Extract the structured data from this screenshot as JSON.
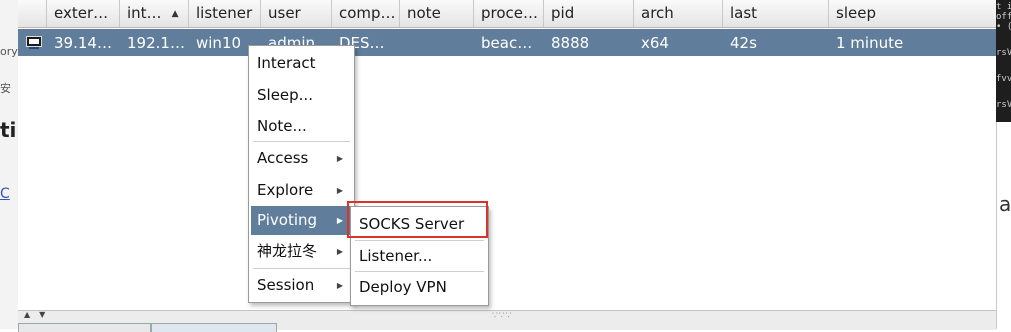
{
  "table": {
    "columns": [
      "exter…",
      "int…",
      "listener",
      "user",
      "comp…",
      "note",
      "proce…",
      "pid",
      "arch",
      "last",
      "sleep"
    ],
    "row": {
      "external": "39.14…",
      "internal": "192.1…",
      "listener": "win10",
      "user": "admin",
      "computer": "DES…",
      "note": "",
      "process": "beac…",
      "pid": "8888",
      "arch": "x64",
      "last": "42s",
      "sleep": "1 minute"
    },
    "sort_icon": "sort-ascending-icon"
  },
  "context_menu": {
    "items": [
      {
        "label": "Interact",
        "submenu": false
      },
      {
        "label": "Sleep...",
        "submenu": false
      },
      {
        "label": "Note...",
        "submenu": false
      },
      {
        "label": "Access",
        "submenu": true
      },
      {
        "label": "Explore",
        "submenu": true
      },
      {
        "label": "Pivoting",
        "submenu": true,
        "active": true
      },
      {
        "label": "神龙拉冬",
        "submenu": true
      },
      {
        "label": "Session",
        "submenu": true
      }
    ]
  },
  "pivoting_submenu": {
    "items": [
      {
        "label": "SOCKS Server",
        "highlighted": true
      },
      {
        "label": "Listener..."
      },
      {
        "label": "Deploy VPN"
      }
    ]
  },
  "background": {
    "left_fragments": [
      "ory",
      "安",
      "ti",
      "C"
    ],
    "right_fragments": [
      "t i",
      "off",
      "• (",
      "rsV",
      "fvv",
      "rsV"
    ],
    "right_big": "a"
  },
  "colors": {
    "selection": "#607e9c",
    "highlight_box": "#d9342b"
  }
}
